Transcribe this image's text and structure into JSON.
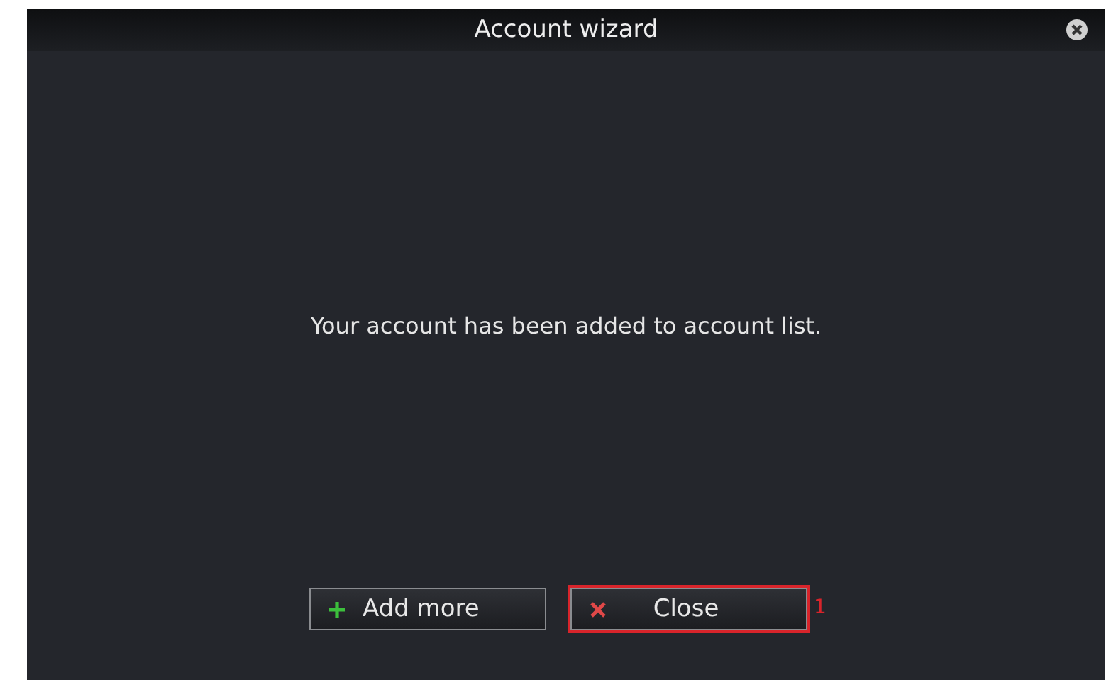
{
  "window": {
    "title": "Account wizard"
  },
  "message": "Your account has been added to account list.",
  "buttons": [
    {
      "label": "Add more",
      "kind": "add",
      "highlighted": false
    },
    {
      "label": "Close",
      "kind": "close",
      "highlighted": true
    }
  ],
  "annotation": {
    "marker": "1"
  }
}
